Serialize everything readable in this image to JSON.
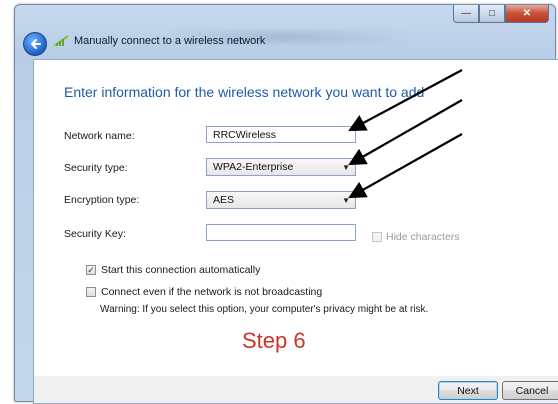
{
  "window": {
    "breadcrumb": "Manually connect to a wireless network",
    "buttons": {
      "minimize": "—",
      "maximize": "□",
      "close": "✕"
    }
  },
  "content": {
    "heading": "Enter information for the wireless network you want to add",
    "network_name": {
      "label": "Network name:",
      "value": "RRCWireless"
    },
    "security_type": {
      "label": "Security type:",
      "value": "WPA2-Enterprise"
    },
    "encryption_type": {
      "label": "Encryption type:",
      "value": "AES"
    },
    "security_key": {
      "label": "Security Key:",
      "value": ""
    },
    "hide_characters": {
      "label": "Hide characters",
      "checked": false
    },
    "start_auto": {
      "label": "Start this connection automatically",
      "checked": true
    },
    "connect_broadcast": {
      "label": "Connect even if the network is not broadcasting",
      "checked": false
    },
    "warning": "Warning: If you select this option, your computer's privacy might be at risk."
  },
  "annotation": {
    "step_text": "Step 6",
    "color": "#c8352b"
  },
  "footer": {
    "next_label": "Next",
    "cancel_label": "Cancel"
  },
  "icons": [
    "back-arrow-icon",
    "wireless-network-icon",
    "dropdown-caret-icon",
    "annotation-arrow-icon"
  ]
}
